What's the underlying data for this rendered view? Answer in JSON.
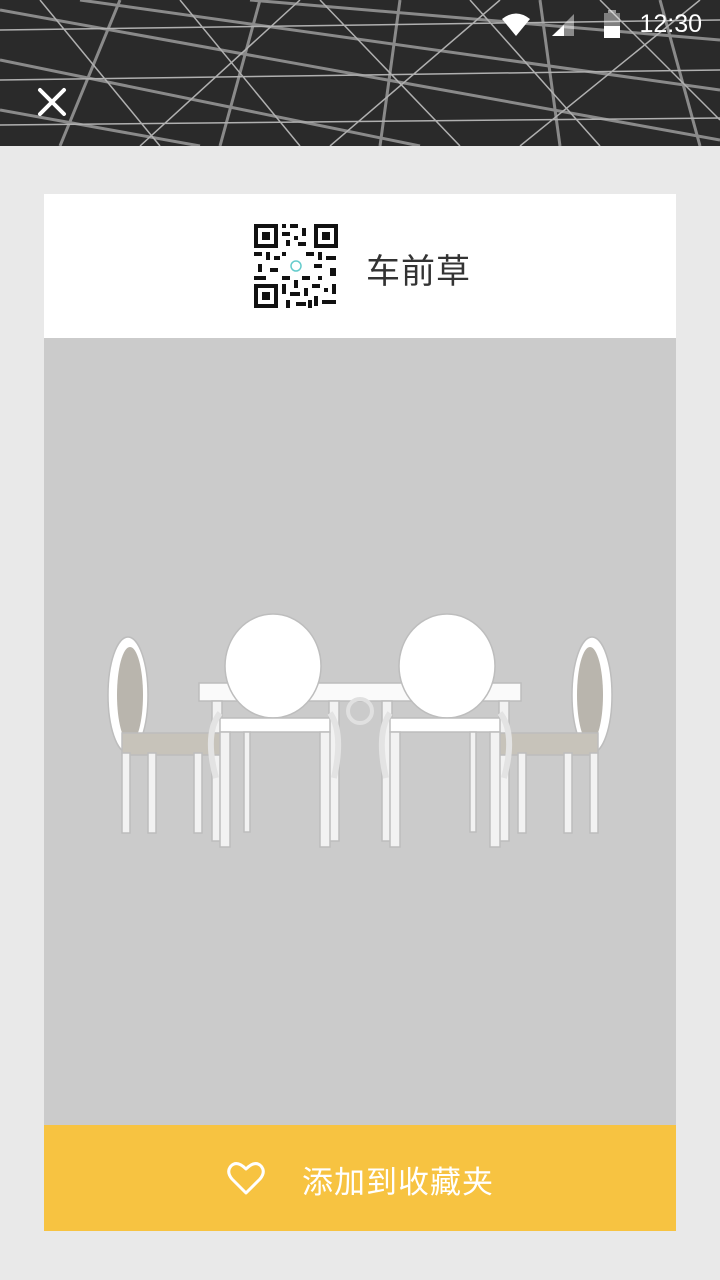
{
  "status_bar": {
    "time": "12:30",
    "icons": [
      "wifi-icon",
      "signal-icon",
      "battery-icon"
    ]
  },
  "header": {
    "close_icon": "close-icon"
  },
  "card": {
    "title": "车前草",
    "qr_icon": "qr-code-icon",
    "image_subject": "chairs-and-table"
  },
  "favorite_button": {
    "label": "添加到收藏夹",
    "icon": "heart-icon"
  },
  "colors": {
    "accent": "#f7c341",
    "page_bg": "#e9e9e9",
    "preview_bg": "#cbcbcb",
    "header_bg": "#262626"
  }
}
